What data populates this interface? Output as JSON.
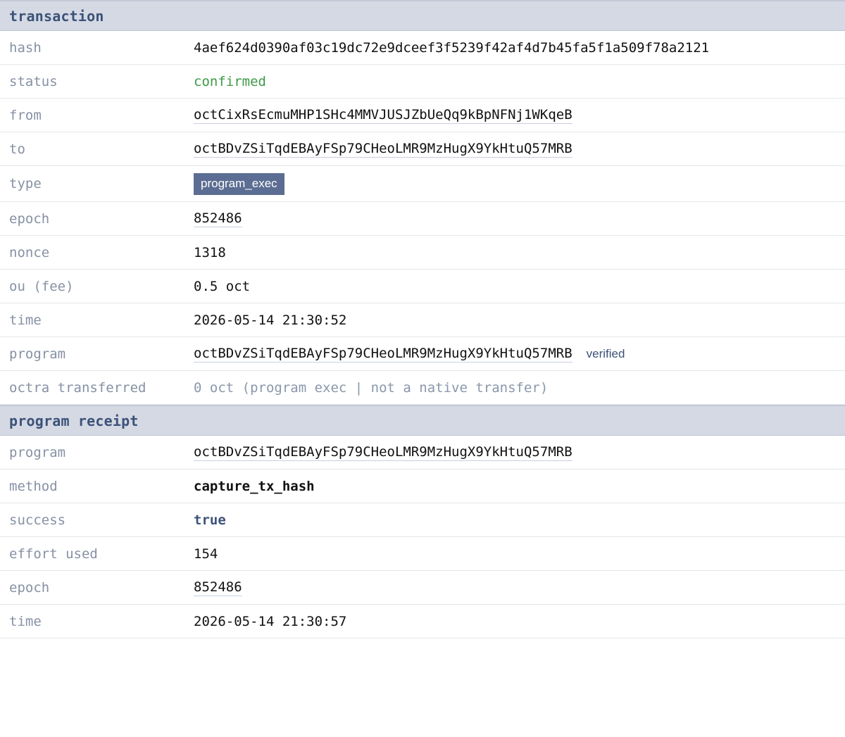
{
  "transaction": {
    "header": "transaction",
    "hash": {
      "label": "hash",
      "value": "4aef624d0390af03c19dc72e9dceef3f5239f42af4d7b45fa5f1a509f78a2121"
    },
    "status": {
      "label": "status",
      "value": "confirmed",
      "color": "#3c9a46"
    },
    "from": {
      "label": "from",
      "value": "octCixRsEcmuMHP1SHc4MMVJUSJZbUeQq9kBpNFNj1WKqeB"
    },
    "to": {
      "label": "to",
      "value": "octBDvZSiTqdEBAyFSp79CHeoLMR9MzHugX9YkHtuQ57MRB"
    },
    "type": {
      "label": "type",
      "value": "program_exec",
      "badge_color": "#5b6d92"
    },
    "epoch": {
      "label": "epoch",
      "value": "852486"
    },
    "nonce": {
      "label": "nonce",
      "value": "1318"
    },
    "fee": {
      "label": "ou (fee)",
      "value": "0.5 oct"
    },
    "time": {
      "label": "time",
      "value": "2026-05-14 21:30:52"
    },
    "program": {
      "label": "program",
      "value": "octBDvZSiTqdEBAyFSp79CHeoLMR9MzHugX9YkHtuQ57MRB",
      "verified": "verified"
    },
    "transferred": {
      "label": "octra transferred",
      "value": "0 oct (program exec | not a native transfer)"
    }
  },
  "receipt": {
    "header": "program receipt",
    "program": {
      "label": "program",
      "value": "octBDvZSiTqdEBAyFSp79CHeoLMR9MzHugX9YkHtuQ57MRB"
    },
    "method": {
      "label": "method",
      "value": "capture_tx_hash"
    },
    "success": {
      "label": "success",
      "value": "true"
    },
    "effort": {
      "label": "effort used",
      "value": "154"
    },
    "epoch": {
      "label": "epoch",
      "value": "852486"
    },
    "time": {
      "label": "time",
      "value": "2026-05-14 21:30:57"
    }
  },
  "colors": {
    "header_bg": "#d4d9e4",
    "header_text": "#3c5278",
    "label_text": "#8691a4",
    "accent": "#3c5278"
  }
}
